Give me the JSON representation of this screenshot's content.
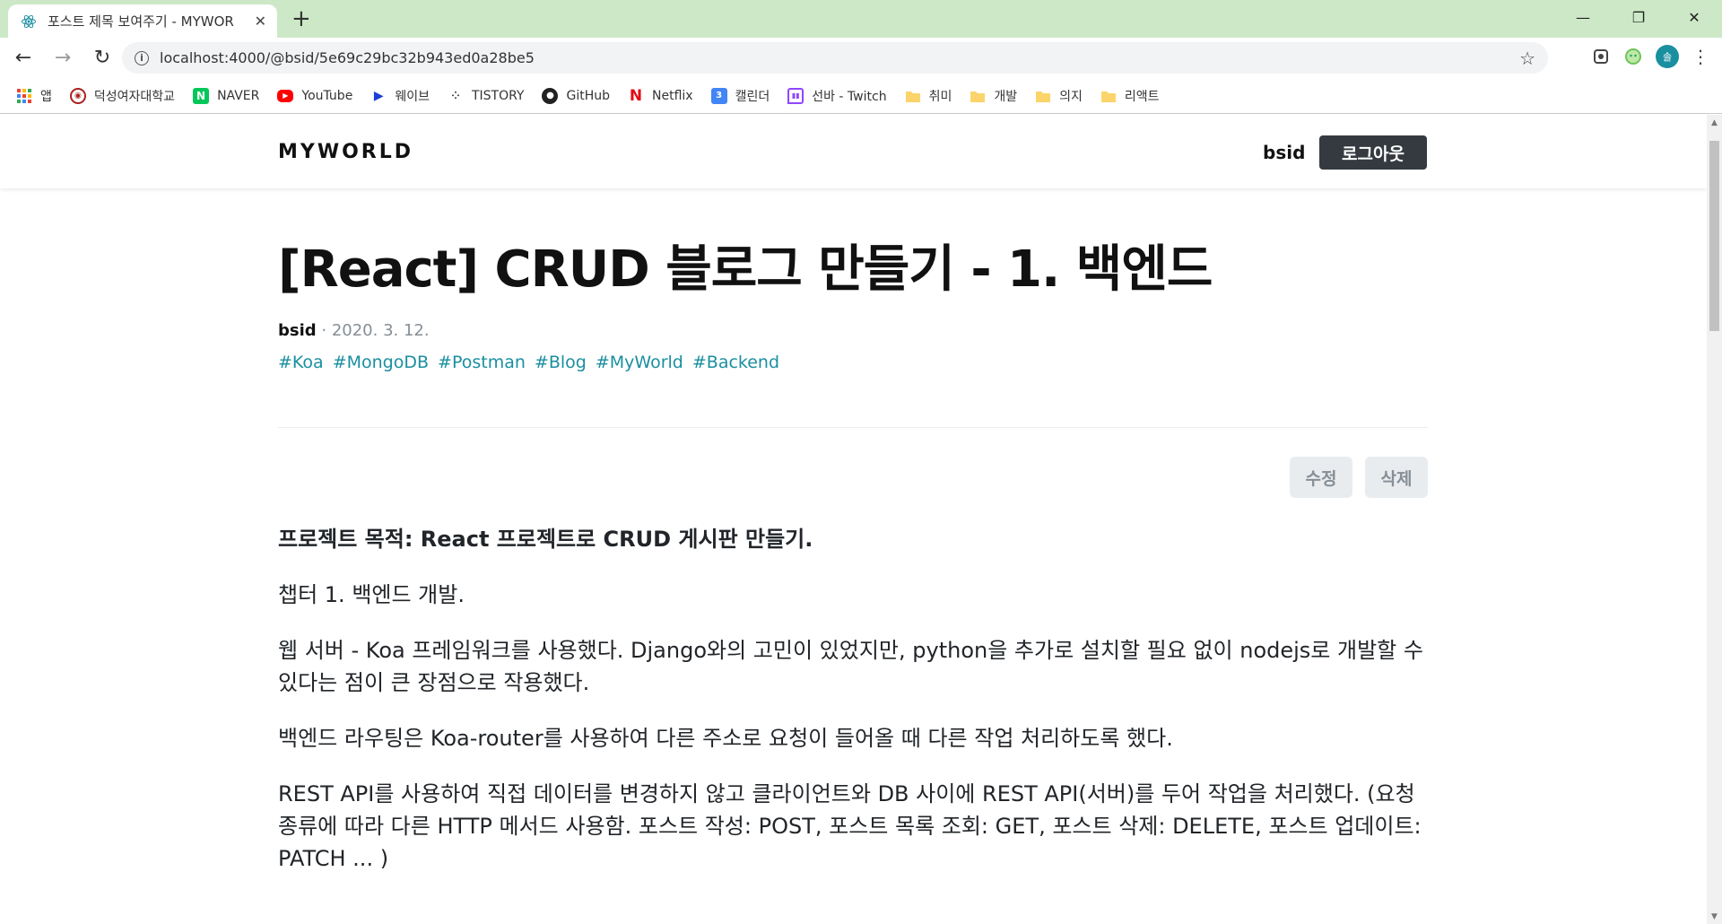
{
  "browser": {
    "tab_title": "포스트 제목 보여주기 - MYWOR",
    "url": "localhost:4000/@bsid/5e69c29bc32b943ed0a28be5",
    "profile_initial": "솔",
    "bookmarks": [
      {
        "label": "앱",
        "icon": "apps-grid-icon"
      },
      {
        "label": "덕성여자대학교",
        "icon": "university-seal-icon"
      },
      {
        "label": "NAVER",
        "icon": "naver-icon"
      },
      {
        "label": "YouTube",
        "icon": "youtube-icon"
      },
      {
        "label": "웨이브",
        "icon": "wavve-icon"
      },
      {
        "label": "TISTORY",
        "icon": "tistory-icon"
      },
      {
        "label": "GitHub",
        "icon": "github-icon"
      },
      {
        "label": "Netflix",
        "icon": "netflix-icon"
      },
      {
        "label": "캘린더",
        "icon": "calendar-icon"
      },
      {
        "label": "선바 - Twitch",
        "icon": "twitch-icon"
      },
      {
        "label": "취미",
        "icon": "folder-icon"
      },
      {
        "label": "개발",
        "icon": "folder-icon"
      },
      {
        "label": "의지",
        "icon": "folder-icon"
      },
      {
        "label": "리액트",
        "icon": "folder-icon"
      }
    ]
  },
  "header": {
    "logo": "MYWORLD",
    "username": "bsid",
    "logout_label": "로그아웃"
  },
  "post": {
    "title": "[React] CRUD 블로그 만들기 - 1. 백엔드",
    "author": "bsid",
    "date": "2020. 3. 12.",
    "separator": " · ",
    "tags": [
      "#Koa",
      "#MongoDB",
      "#Postman",
      "#Blog",
      "#MyWorld",
      "#Backend"
    ],
    "edit_label": "수정",
    "delete_label": "삭제",
    "paragraphs": [
      "프로젝트 목적: React 프로젝트로 CRUD 게시판 만들기.",
      "챕터 1. 백엔드 개발.",
      "웹 서버 - Koa 프레임워크를 사용했다. Django와의 고민이 있었지만, python을 추가로 설치할 필요 없이 nodejs로 개발할 수 있다는 점이 큰 장점으로 작용했다.",
      "백엔드 라우팅은 Koa-router를 사용하여 다른 주소로 요청이 들어올 때 다른 작업 처리하도록 했다.",
      "REST API를 사용하여 직접 데이터를 변경하지 않고 클라이언트와 DB 사이에 REST API(서버)를 두어 작업을 처리했다. (요청 종류에 따라 다른 HTTP 메서드 사용함. 포스트 작성: POST, 포스트 목록 조회: GET, 포스트 삭제: DELETE, 포스트 업데이트: PATCH ... )"
    ]
  },
  "colors": {
    "tabstrip": "#cde8c6",
    "tag": "#1a8fa0",
    "logout_bg": "#343a40"
  }
}
